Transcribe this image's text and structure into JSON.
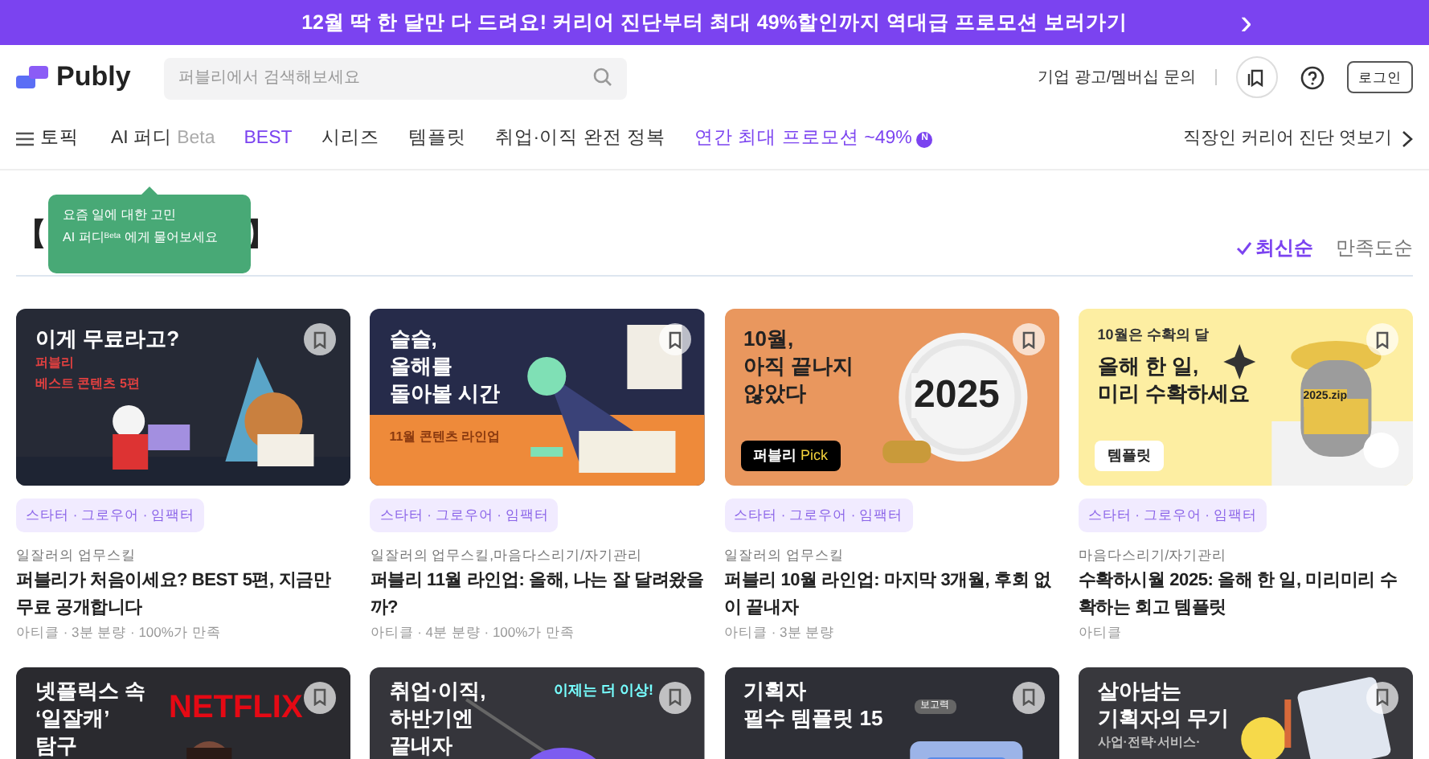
{
  "promo_banner": {
    "text": "12월 딱 한 달만 다 드려요! 커리어 진단부터 최대 49%할인까지 역대급 프로모션 보러가기",
    "arrow": "›"
  },
  "header": {
    "logo": "Publy",
    "search": {
      "placeholder": "퍼블리에서 검색해보세요"
    },
    "link": "기업 광고/멤버십 문의",
    "login": "로그인"
  },
  "nav": {
    "menu": "토픽",
    "items": [
      {
        "label": "AI 퍼디",
        "suffix": "Beta",
        "kind": "beta"
      },
      {
        "label": "BEST",
        "kind": "accent"
      },
      {
        "label": "시리즈",
        "kind": "plain"
      },
      {
        "label": "템플릿",
        "kind": "plain"
      },
      {
        "label": "취업·이직 완전 정복",
        "kind": "plain"
      },
      {
        "label": "연간 최대 프로모션 ~49%",
        "suffix": "N",
        "kind": "promo"
      }
    ],
    "right_link": "직장인 커리어 진단 엿보기"
  },
  "section": {
    "bracket_open": "【",
    "bracket_close": "】",
    "tooltip": {
      "line_1": "요즘 일에 대한 고민",
      "line_2": "AI 퍼디$^{Beta}$ 에게 물어보세요"
    },
    "sort": [
      {
        "label": "최신순",
        "selected": true
      },
      {
        "label": "만족도순",
        "selected": false
      }
    ]
  },
  "cards": [
    {
      "thumb": {
        "kind": "santa",
        "headline": [
          "이게 무료라고?"
        ],
        "note": [
          "퍼블리",
          "베스트 콘텐츠 5편"
        ]
      },
      "tags": "스타터 · 그로우어 · 임팩터",
      "category": "일잘러의 업무스킬",
      "title": "퍼블리가 처음이세요? BEST 5편, 지금만 무료 공개합니다",
      "meta": "아티클 · 3분 분량 · 100%가 만족"
    },
    {
      "thumb": {
        "kind": "lamp",
        "headline": [
          "슬슬,",
          "올해를",
          "돌아볼 시간"
        ],
        "note": [
          "11월 콘텐츠 라인업"
        ]
      },
      "tags": "스타터 · 그로우어 · 임팩터",
      "category": "일잘러의 업무스킬,마음다스리기/자기관리",
      "title": "퍼블리 11월 라인업: 올해, 나는 잘 달려왔을까?",
      "meta": "아티클 · 4분 분량 · 100%가 만족"
    },
    {
      "thumb": {
        "kind": "target",
        "headline": [
          "10월,",
          "아직 끝나지",
          "않았다"
        ],
        "badge": "퍼블리 **Pick**",
        "art": "2025"
      },
      "tags": "스타터 · 그로우어 · 임팩터",
      "category": "일잘러의 업무스킬",
      "title": "퍼블리 10월 라인업: 마지막 3개월, 후회 없이 끝내자",
      "meta": "아티클 · 3분 분량"
    },
    {
      "thumb": {
        "kind": "robot",
        "kicker": "10월은 수확의 달",
        "headline": [
          "올해 한 일,",
          "미리 수확하세요"
        ],
        "badge": "템플릿",
        "art": "2025.zip"
      },
      "tags": "스타터 · 그로우어 · 임팩터",
      "category": "마음다스리기/자기관리",
      "title": "수확하시월 2025: 올해 한 일, 미리미리 수확하는 회고 템플릿",
      "meta": "아티클"
    },
    {
      "thumb": {
        "kind": "netflix",
        "headline": [
          "넷플릭스 속",
          "‘일잘캐’",
          "탐구"
        ],
        "art": "NETFLIX"
      }
    },
    {
      "thumb": {
        "kind": "career",
        "headline": [
          "취업·이직,",
          "하반기엔",
          "끝내자"
        ],
        "art": "이제는 더 이상!"
      }
    },
    {
      "thumb": {
        "kind": "templates",
        "headline": [
          "기획자",
          "필수 템플릿 15"
        ],
        "art": "보고력"
      }
    },
    {
      "thumb": {
        "kind": "tools",
        "headline": [
          "살아남는",
          "기획자의 무기"
        ],
        "note": [
          "사업·전략·서비스·"
        ]
      }
    }
  ]
}
